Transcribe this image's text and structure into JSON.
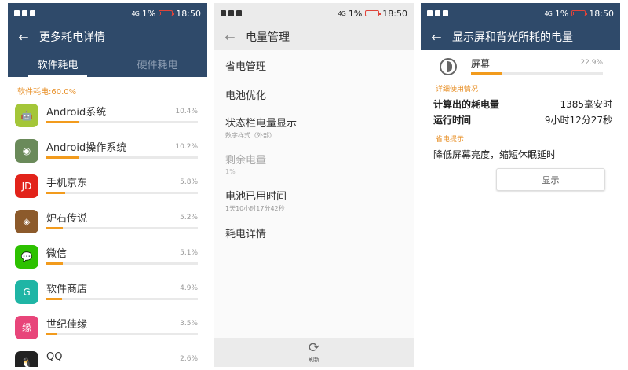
{
  "status_bar": {
    "signal": "4G",
    "battery_pct": "1%",
    "time": "18:50"
  },
  "colors": {
    "header_dark": "#2f4a6a",
    "accent_orange": "#f29b1d",
    "header_light": "#ebebeb"
  },
  "panel1": {
    "title": "更多耗电详情",
    "tabs": [
      "软件耗电",
      "硬件耗电"
    ],
    "summary": "软件耗电:60.0%",
    "apps": [
      {
        "name": "Android系统",
        "pct": "10.4%",
        "value": 10.4,
        "icon": "android-robot-icon",
        "icon_color": "#a4c639",
        "glyph": "🤖"
      },
      {
        "name": "Android操作系统",
        "pct": "10.2%",
        "value": 10.2,
        "icon": "android-os-disc-icon",
        "icon_color": "#6a8a5a",
        "glyph": "◉"
      },
      {
        "name": "手机京东",
        "pct": "5.8%",
        "value": 5.8,
        "icon": "jd-icon",
        "icon_color": "#e2231a",
        "glyph": "JD"
      },
      {
        "name": "炉石传说",
        "pct": "5.2%",
        "value": 5.2,
        "icon": "hearthstone-icon",
        "icon_color": "#8c5a2b",
        "glyph": "◈"
      },
      {
        "name": "微信",
        "pct": "5.1%",
        "value": 5.1,
        "icon": "wechat-icon",
        "icon_color": "#2dc100",
        "glyph": "💬"
      },
      {
        "name": "软件商店",
        "pct": "4.9%",
        "value": 4.9,
        "icon": "app-store-icon",
        "icon_color": "#1fb5a5",
        "glyph": "G"
      },
      {
        "name": "世纪佳缘",
        "pct": "3.5%",
        "value": 3.5,
        "icon": "jiayuan-icon",
        "icon_color": "#e8457a",
        "glyph": "缘"
      },
      {
        "name": "QQ",
        "pct": "2.6%",
        "value": 2.6,
        "icon": "qq-penguin-icon",
        "icon_color": "#222222",
        "glyph": "🐧"
      }
    ]
  },
  "panel2": {
    "title": "电量管理",
    "items": [
      {
        "label": "省电管理",
        "sub": "",
        "disabled": false
      },
      {
        "label": "电池优化",
        "sub": "",
        "disabled": false
      },
      {
        "label": "状态栏电量显示",
        "sub": "数字样式（外部）",
        "disabled": false
      },
      {
        "label": "剩余电量",
        "sub": "1%",
        "disabled": true
      },
      {
        "label": "电池已用时间",
        "sub": "1天10小时17分42秒",
        "disabled": false
      },
      {
        "label": "耗电详情",
        "sub": "",
        "disabled": false
      }
    ],
    "refresh_label": "刷新"
  },
  "panel3": {
    "title": "显示屏和背光所耗的电量",
    "screen_name": "屏幕",
    "screen_pct": "22.9%",
    "screen_value": 22.9,
    "detail_head": "详细使用情况",
    "details": [
      {
        "label": "计算出的耗电量",
        "value": "1385毫安时"
      },
      {
        "label": "运行时间",
        "value": "9小时12分27秒"
      }
    ],
    "tip_head": "省电提示",
    "tip_text": "降低屏幕亮度，缩短休眠延时",
    "show_button": "显示"
  }
}
